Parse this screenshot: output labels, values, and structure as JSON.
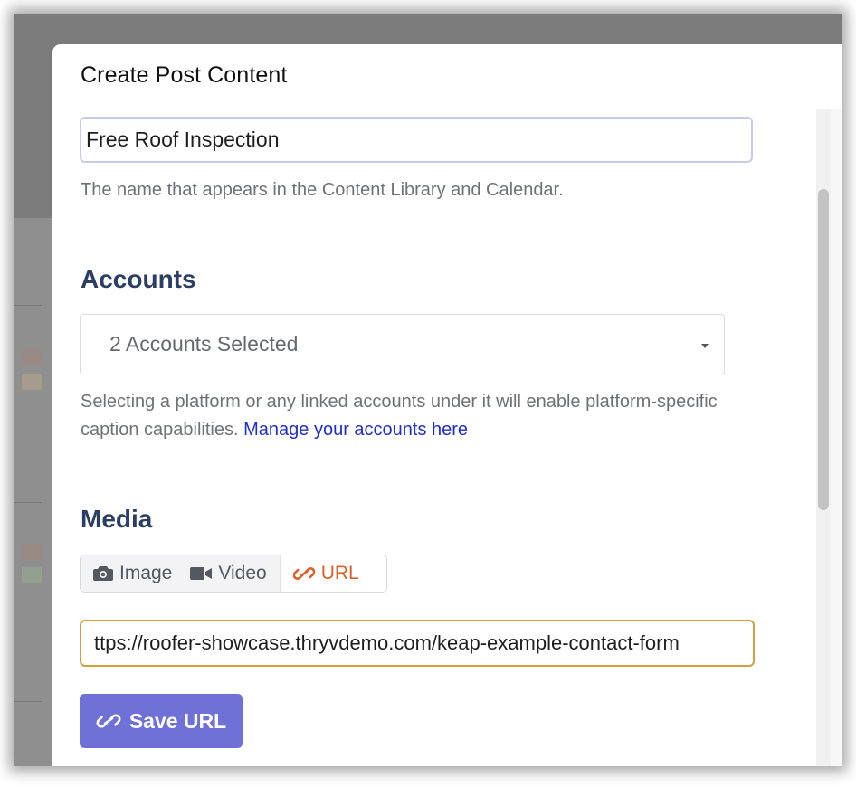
{
  "modal": {
    "title": "Create Post Content"
  },
  "post_name": {
    "value": "Free Roof Inspection",
    "help": "The name that appears in the Content Library and Calendar."
  },
  "accounts": {
    "heading": "Accounts",
    "selected": "2 Accounts Selected",
    "help": "Selecting a platform or any linked accounts under it will enable platform-specific caption capabilities.",
    "manage_link": "Manage your accounts here"
  },
  "media": {
    "heading": "Media",
    "tabs": [
      {
        "label": "Image",
        "icon": "camera-icon",
        "active": false
      },
      {
        "label": "Video",
        "icon": "video-icon",
        "active": false
      },
      {
        "label": "URL",
        "icon": "link-icon",
        "active": true
      }
    ],
    "url_value": "ttps://roofer-showcase.thryvdemo.com/keap-example-contact-form",
    "save_label": "Save URL"
  },
  "colors": {
    "accent": "#6f71d7",
    "active_tab": "#d9622b",
    "heading": "#2c3e63",
    "link": "#2230c2",
    "focus_border": "#d49f3f"
  }
}
